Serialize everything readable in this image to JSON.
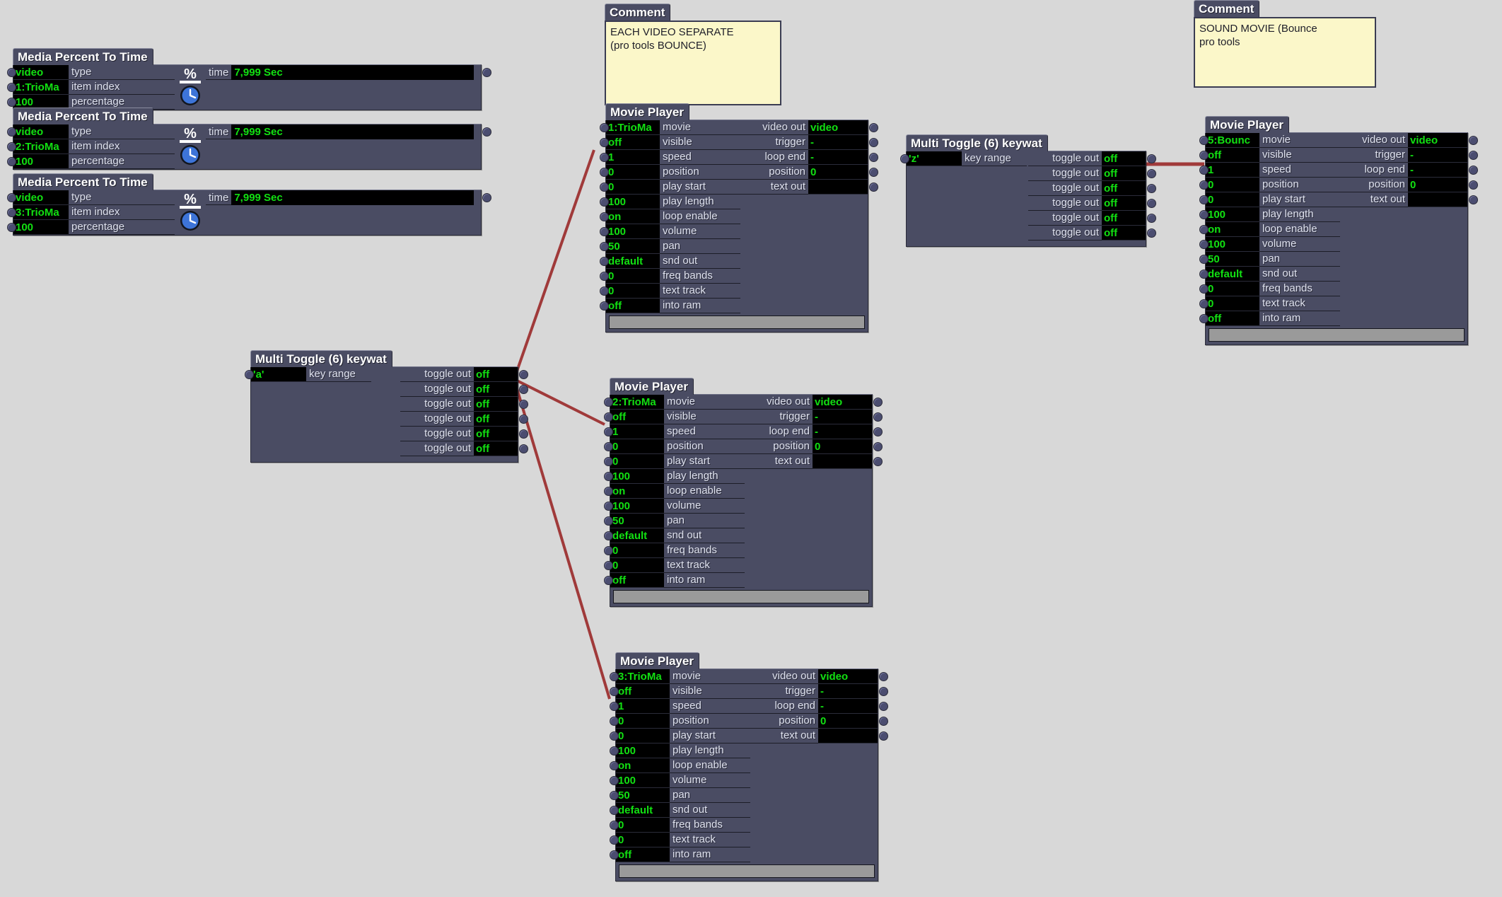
{
  "app": {
    "canvas_background": "#d8d8d8",
    "node_fill": "#4a4c63",
    "value_text_color": "#12e012",
    "wire_color": "#a03a3a",
    "comment_fill": "#fbf7c9"
  },
  "media_percent_nodes": [
    {
      "title": "Media Percent To Time",
      "icon": "percent-over-clock-icon",
      "inputs": [
        {
          "value": "video",
          "label": "type"
        },
        {
          "value": "1:TrioMa",
          "label": "item index"
        },
        {
          "value": "100",
          "label": "percentage"
        }
      ],
      "output": {
        "label": "time",
        "value": "7,999 Sec"
      }
    },
    {
      "title": "Media Percent To Time",
      "icon": "percent-over-clock-icon",
      "inputs": [
        {
          "value": "video",
          "label": "type"
        },
        {
          "value": "2:TrioMa",
          "label": "item index"
        },
        {
          "value": "100",
          "label": "percentage"
        }
      ],
      "output": {
        "label": "time",
        "value": "7,999 Sec"
      }
    },
    {
      "title": "Media Percent To Time",
      "icon": "percent-over-clock-icon",
      "inputs": [
        {
          "value": "video",
          "label": "type"
        },
        {
          "value": "3:TrioMa",
          "label": "item index"
        },
        {
          "value": "100",
          "label": "percentage"
        }
      ],
      "output": {
        "label": "time",
        "value": "7,999 Sec"
      }
    }
  ],
  "comments": [
    {
      "title": "Comment",
      "text": "EACH VIDEO SEPARATE\n(pro tools BOUNCE)"
    },
    {
      "title": "Comment",
      "text": "SOUND MOVIE (Bounce\npro tools"
    }
  ],
  "multi_toggles": [
    {
      "title": "Multi Toggle (6) keywat",
      "key_range_value": "'a'",
      "key_range_label": "key range",
      "outputs": [
        {
          "label": "toggle out",
          "value": "off"
        },
        {
          "label": "toggle out",
          "value": "off"
        },
        {
          "label": "toggle out",
          "value": "off"
        },
        {
          "label": "toggle out",
          "value": "off"
        },
        {
          "label": "toggle out",
          "value": "off"
        },
        {
          "label": "toggle out",
          "value": "off"
        }
      ]
    },
    {
      "title": "Multi Toggle (6) keywat",
      "key_range_value": "'z'",
      "key_range_label": "key range",
      "outputs": [
        {
          "label": "toggle out",
          "value": "off"
        },
        {
          "label": "toggle out",
          "value": "off"
        },
        {
          "label": "toggle out",
          "value": "off"
        },
        {
          "label": "toggle out",
          "value": "off"
        },
        {
          "label": "toggle out",
          "value": "off"
        },
        {
          "label": "toggle out",
          "value": "off"
        }
      ]
    }
  ],
  "movie_players": [
    {
      "title": "Movie Player",
      "inputs": [
        {
          "value": "1:TrioMa",
          "label": "movie"
        },
        {
          "value": "off",
          "label": "visible"
        },
        {
          "value": "1",
          "label": "speed"
        },
        {
          "value": "0",
          "label": "position"
        },
        {
          "value": "0",
          "label": "play start"
        },
        {
          "value": "100",
          "label": "play length"
        },
        {
          "value": "on",
          "label": "loop enable"
        },
        {
          "value": "100",
          "label": "volume"
        },
        {
          "value": "50",
          "label": "pan"
        },
        {
          "value": "default",
          "label": "snd out"
        },
        {
          "value": "0",
          "label": "freq bands"
        },
        {
          "value": "0",
          "label": "text track"
        },
        {
          "value": "off",
          "label": "into ram"
        }
      ],
      "outputs": [
        {
          "label": "video out",
          "value": "video"
        },
        {
          "label": "trigger",
          "value": "-"
        },
        {
          "label": "loop end",
          "value": "-"
        },
        {
          "label": "position",
          "value": "0"
        },
        {
          "label": "text out",
          "value": ""
        }
      ]
    },
    {
      "title": "Movie Player",
      "inputs": [
        {
          "value": "2:TrioMa",
          "label": "movie"
        },
        {
          "value": "off",
          "label": "visible"
        },
        {
          "value": "1",
          "label": "speed"
        },
        {
          "value": "0",
          "label": "position"
        },
        {
          "value": "0",
          "label": "play start"
        },
        {
          "value": "100",
          "label": "play length"
        },
        {
          "value": "on",
          "label": "loop enable"
        },
        {
          "value": "100",
          "label": "volume"
        },
        {
          "value": "50",
          "label": "pan"
        },
        {
          "value": "default",
          "label": "snd out"
        },
        {
          "value": "0",
          "label": "freq bands"
        },
        {
          "value": "0",
          "label": "text track"
        },
        {
          "value": "off",
          "label": "into ram"
        }
      ],
      "outputs": [
        {
          "label": "video out",
          "value": "video"
        },
        {
          "label": "trigger",
          "value": "-"
        },
        {
          "label": "loop end",
          "value": "-"
        },
        {
          "label": "position",
          "value": "0"
        },
        {
          "label": "text out",
          "value": ""
        }
      ]
    },
    {
      "title": "Movie Player",
      "inputs": [
        {
          "value": "3:TrioMa",
          "label": "movie"
        },
        {
          "value": "off",
          "label": "visible"
        },
        {
          "value": "1",
          "label": "speed"
        },
        {
          "value": "0",
          "label": "position"
        },
        {
          "value": "0",
          "label": "play start"
        },
        {
          "value": "100",
          "label": "play length"
        },
        {
          "value": "on",
          "label": "loop enable"
        },
        {
          "value": "100",
          "label": "volume"
        },
        {
          "value": "50",
          "label": "pan"
        },
        {
          "value": "default",
          "label": "snd out"
        },
        {
          "value": "0",
          "label": "freq bands"
        },
        {
          "value": "0",
          "label": "text track"
        },
        {
          "value": "off",
          "label": "into ram"
        }
      ],
      "outputs": [
        {
          "label": "video out",
          "value": "video"
        },
        {
          "label": "trigger",
          "value": "-"
        },
        {
          "label": "loop end",
          "value": "-"
        },
        {
          "label": "position",
          "value": "0"
        },
        {
          "label": "text out",
          "value": ""
        }
      ]
    },
    {
      "title": "Movie Player",
      "inputs": [
        {
          "value": "5:Bounc",
          "label": "movie"
        },
        {
          "value": "off",
          "label": "visible"
        },
        {
          "value": "1",
          "label": "speed"
        },
        {
          "value": "0",
          "label": "position"
        },
        {
          "value": "0",
          "label": "play start"
        },
        {
          "value": "100",
          "label": "play length"
        },
        {
          "value": "on",
          "label": "loop enable"
        },
        {
          "value": "100",
          "label": "volume"
        },
        {
          "value": "50",
          "label": "pan"
        },
        {
          "value": "default",
          "label": "snd out"
        },
        {
          "value": "0",
          "label": "freq bands"
        },
        {
          "value": "0",
          "label": "text track"
        },
        {
          "value": "off",
          "label": "into ram"
        }
      ],
      "outputs": [
        {
          "label": "video out",
          "value": "video"
        },
        {
          "label": "trigger",
          "value": "-"
        },
        {
          "label": "loop end",
          "value": "-"
        },
        {
          "label": "position",
          "value": "0"
        },
        {
          "label": "text out",
          "value": ""
        }
      ]
    }
  ],
  "connections": [
    {
      "from": "multi-toggle-a.toggle-out-1",
      "to": "movie-player-1.visible"
    },
    {
      "from": "multi-toggle-a.toggle-out-1",
      "to": "movie-player-2.visible"
    },
    {
      "from": "multi-toggle-a.toggle-out-1",
      "to": "movie-player-3.visible"
    },
    {
      "from": "multi-toggle-z.toggle-out-1",
      "to": "movie-player-4.visible"
    }
  ]
}
